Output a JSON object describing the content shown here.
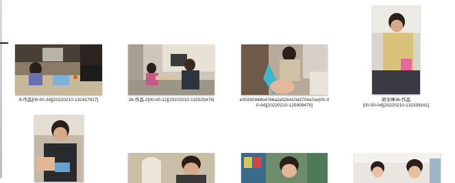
{
  "files": [
    {
      "caption_line1": "9-作品[00-00-34][20220210-132417917]",
      "caption_line2": "",
      "kind": "video-thumbnail"
    },
    {
      "caption_line1": "26-作品-2[00-00-12][20220210-132525478]",
      "caption_line2": "",
      "kind": "video-thumbnail"
    },
    {
      "caption_line1": "e00280948b4766a2e52b410d3704a7ee[00-0",
      "caption_line2": "0-04][20220210-125909470]",
      "kind": "video-thumbnail"
    },
    {
      "caption_line1": "郭文峰36-作品",
      "caption_line2": "[00-00-04][20220210-132339161]",
      "kind": "video-thumbnail"
    },
    {
      "caption_line1": "",
      "caption_line2": "",
      "kind": "video-thumbnail"
    },
    {
      "caption_line1": "",
      "caption_line2": "",
      "kind": "video-thumbnail"
    },
    {
      "caption_line1": "",
      "caption_line2": "",
      "kind": "video-thumbnail"
    },
    {
      "caption_line1": "",
      "caption_line2": "",
      "kind": "video-thumbnail"
    }
  ]
}
